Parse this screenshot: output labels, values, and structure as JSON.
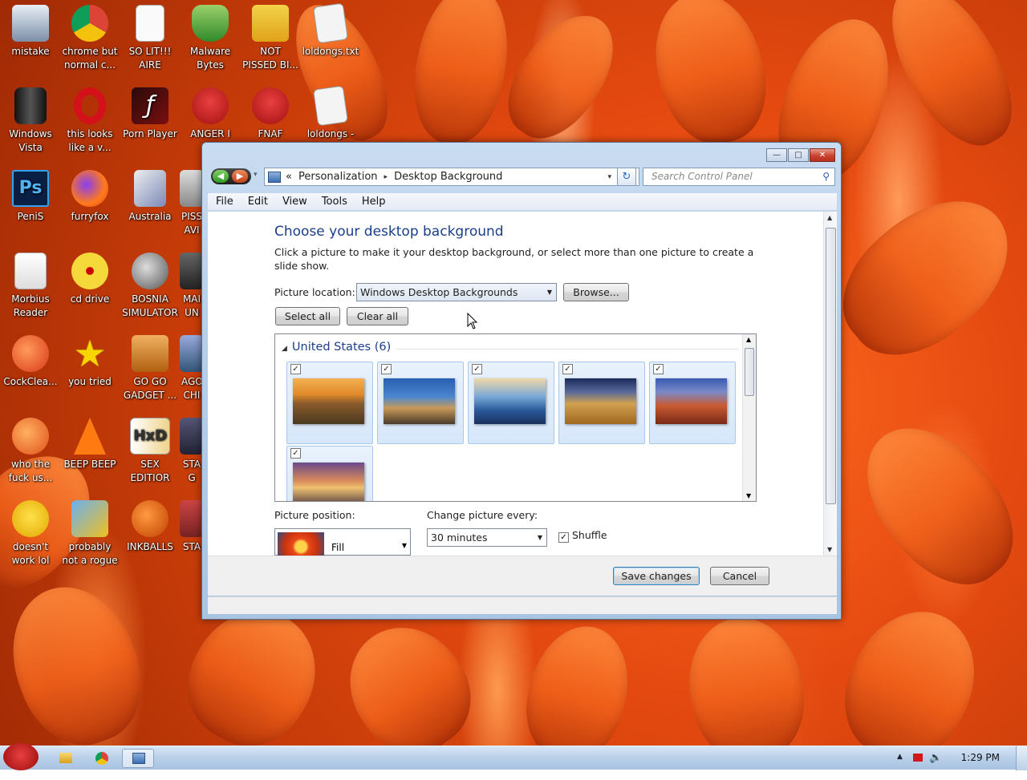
{
  "desktop": {
    "icons": [
      {
        "label": "mistake",
        "icon": "monitor-hammer-icon"
      },
      {
        "label": "chrome but normal c...",
        "icon": "chrome-icon"
      },
      {
        "label": "SO LIT!!! AIRE",
        "icon": "playing-card-icon"
      },
      {
        "label": "Malware Bytes",
        "icon": "shield-check-icon"
      },
      {
        "label": "NOT PISSED BI...",
        "icon": "green-pig-icon"
      },
      {
        "label": "loldongs.txt",
        "icon": "text-file-icon"
      },
      {
        "label": "Windows Vista",
        "icon": "trash-can-icon"
      },
      {
        "label": "this looks like a v...",
        "icon": "opera-icon"
      },
      {
        "label": "Porn Player",
        "icon": "flash-icon"
      },
      {
        "label": "ANGER I",
        "icon": "angry-bird-icon"
      },
      {
        "label": "FNAF",
        "icon": "angry-bird-icon"
      },
      {
        "label": "loldongs -",
        "icon": "text-file-icon"
      },
      {
        "label": "PeniS",
        "icon": "photoshop-icon"
      },
      {
        "label": "furryfox",
        "icon": "firefox-icon"
      },
      {
        "label": "Australia",
        "icon": "spider-icon"
      },
      {
        "label": "PISS AVI",
        "icon": "video-icon"
      },
      {
        "label": "Morbius Reader",
        "icon": "adobe-reader-icon"
      },
      {
        "label": "cd drive",
        "icon": "cd-icon"
      },
      {
        "label": "BOSNIA SIMULATOR",
        "icon": "spiked-ball-icon"
      },
      {
        "label": "MAI UN",
        "icon": "app-icon"
      },
      {
        "label": "CockClea...",
        "icon": "ccleaner-icon"
      },
      {
        "label": "you tried",
        "icon": "star-icon"
      },
      {
        "label": "GO GO GADGET ...",
        "icon": "briefcase-icon"
      },
      {
        "label": "AGO CHI",
        "icon": "app-icon"
      },
      {
        "label": "who the fuck us...",
        "icon": "lightning-icon"
      },
      {
        "label": "BEEP BEEP",
        "icon": "vlc-cone-icon"
      },
      {
        "label": "SEX EDITIOR",
        "icon": "hxd-icon"
      },
      {
        "label": "STA G",
        "icon": "app-icon"
      },
      {
        "label": "doesn't work lol",
        "icon": "yahoo-messenger-icon"
      },
      {
        "label": "probably not a rogue",
        "icon": "gears-icon"
      },
      {
        "label": "INKBALLS",
        "icon": "inkball-icon"
      },
      {
        "label": "STA",
        "icon": "app-icon"
      }
    ]
  },
  "window": {
    "controls": {
      "minimize": "—",
      "maximize": "□",
      "close": "✕"
    },
    "nav": {
      "back": "◀",
      "forward": "▶",
      "dropdown": "▾"
    },
    "address": {
      "chevron": "«",
      "crumbs": [
        "Personalization",
        "Desktop Background"
      ],
      "separator": "▸",
      "dropdown": "▾",
      "refresh": "↻"
    },
    "search": {
      "placeholder": "Search Control Panel",
      "icon": "search-icon",
      "glyph": "⚲"
    },
    "menu": [
      "File",
      "Edit",
      "View",
      "Tools",
      "Help"
    ],
    "heading": "Choose your desktop background",
    "description": "Click a picture to make it your desktop background, or select more than one picture to create a slide show.",
    "picture_location": {
      "label": "Picture location:",
      "value": "Windows Desktop Backgrounds",
      "browse": "Browse..."
    },
    "select_all": "Select all",
    "clear_all": "Clear all",
    "group": {
      "title": "United States (6)",
      "collapse_glyph": "◢",
      "pictures": [
        {
          "name": "sunset-prairie",
          "checked": true
        },
        {
          "name": "lighthouse",
          "checked": true
        },
        {
          "name": "sea-rock",
          "checked": true
        },
        {
          "name": "hay-bale",
          "checked": true
        },
        {
          "name": "delicate-arch",
          "checked": true
        },
        {
          "name": "lake-sunrise",
          "checked": true
        }
      ]
    },
    "picture_position": {
      "label": "Picture position:",
      "value": "Fill"
    },
    "change_every": {
      "label": "Change picture every:",
      "value": "30 minutes"
    },
    "shuffle": {
      "label": "Shuffle",
      "checked": true
    },
    "save": "Save changes",
    "cancel": "Cancel"
  },
  "taskbar": {
    "clock": "1:29 PM",
    "tray_icons": [
      "show-hidden-icon",
      "flag-icon",
      "volume-icon"
    ]
  },
  "colors": {
    "heading_blue": "#1a3e8c",
    "wallpaper_orange": "#e54a10"
  }
}
